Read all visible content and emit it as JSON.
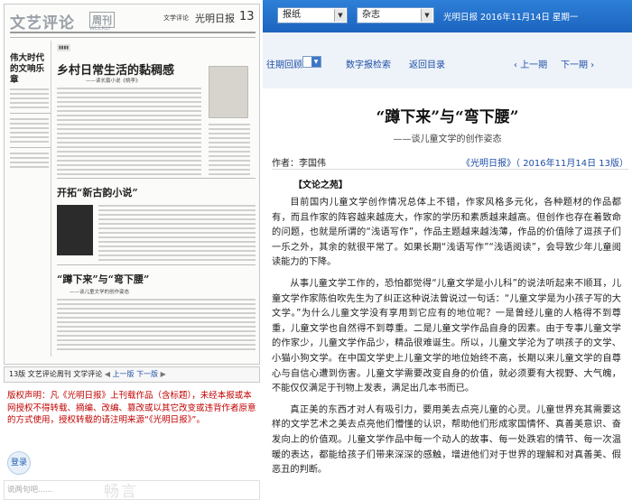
{
  "left": {
    "masthead": {
      "title": "文艺评论",
      "weekly": "周刊",
      "weekly_en": "WEEKLY",
      "section": "文学评论",
      "paper": "光明日报",
      "page_no": "13"
    },
    "headlines": {
      "side": "伟大时代的文响乐章",
      "main": "乡村日常生活的黏稠感",
      "main_sub": "——读长篇小说《桃李》",
      "second": "开拓“新古韵小说”",
      "third": "“蹲下来”与“弯下腰”",
      "third_sub": "——谈儿童文学的创作姿态"
    },
    "page_bar": {
      "label": "13版 文艺评论周刊 文学评论",
      "prev": "上一版",
      "next": "下一版"
    },
    "copyright": "版权声明：凡《光明日报》上刊载作品（含标题），未经本报或本网授权不得转载、摘编、改编、篡改或以其它改变或违背作者原意的方式使用，授权转载的请注明来源“《光明日报》”。",
    "login": "登录",
    "comment_placeholder": "说两句吧......",
    "comment_watermark": "畅言"
  },
  "right": {
    "selects": {
      "type1": "报纸",
      "type2": "杂志"
    },
    "topbar_info": "光明日报  2016年11月14日  星期一",
    "nav": {
      "back_issue": "往期回顾",
      "paper_index": "数字报检索",
      "return_home": "返回目录",
      "prev_page": "上一期",
      "next_page": "下一期"
    },
    "article": {
      "title": "“蹲下来”与“弯下腰”",
      "subtitle": "——谈儿童文学的创作姿态",
      "author": "作者：李国伟",
      "source": "《光明日报》（ 2016年11月14日   13版）",
      "column": "【文论之苑】",
      "paragraphs": [
        "目前国内儿童文学创作情况总体上不错，作家风格多元化，各种题材的作品都有，而且作家的阵容越来越庞大，作家的学历和素质越来越高。但创作也存在着致命的问题，也就是所谓的“浅语写作”，作品主题越来越浅薄，作品的价值除了逗孩子们一乐之外，其余的就很平常了。如果长期“浅语写作”“浅语阅读”，会导致少年儿童阅读能力的下降。",
        "从事儿童文学工作的，恐怕都觉得“儿童文学是小儿科”的说法听起来不顺耳，儿童文学作家陈伯吹先生为了纠正这种说法曾说过一句话：“儿童文学是为小孩子写的大文学。”为什么儿童文学没有享用到它应有的地位呢？一是曾经儿童的人格得不到尊重，儿童文学也自然得不到尊重。二是儿童文学作品自身的因素。由于专事儿童文学的作家少，儿童文学作品少，精品很难诞生。所以，儿童文学沦为了哄孩子的文学、小猫小狗文学。在中国文学史上儿童文学的地位始终不高，长期以来儿童文学的自尊心与自信心遭到伤害。儿童文学需要改变自身的价值，就必须要有大视野、大气魄，不能仅仅满足于刊物上发表，满足出几本书而已。",
        "真正美的东西才对人有吸引力，要用美去点亮儿童的心灵。儿童世界充其需要这样的文学艺术之美去点亮他们懵懂的认识，帮助他们形成家国情怀、真善美意识、奋发向上的价值观。儿童文学作品中每一个动人的故事、每一处跌宕的情节、每一次温暖的表达，都能给孩子们带来深深的感触，增进他们对于世界的理解和对真善美、假恶丑的判断。"
      ]
    }
  },
  "colors": {
    "topbar": "#1f6ccb",
    "link": "#1f4fa5",
    "copyright": "#c00000",
    "nav_bg": "#eef3f9"
  }
}
